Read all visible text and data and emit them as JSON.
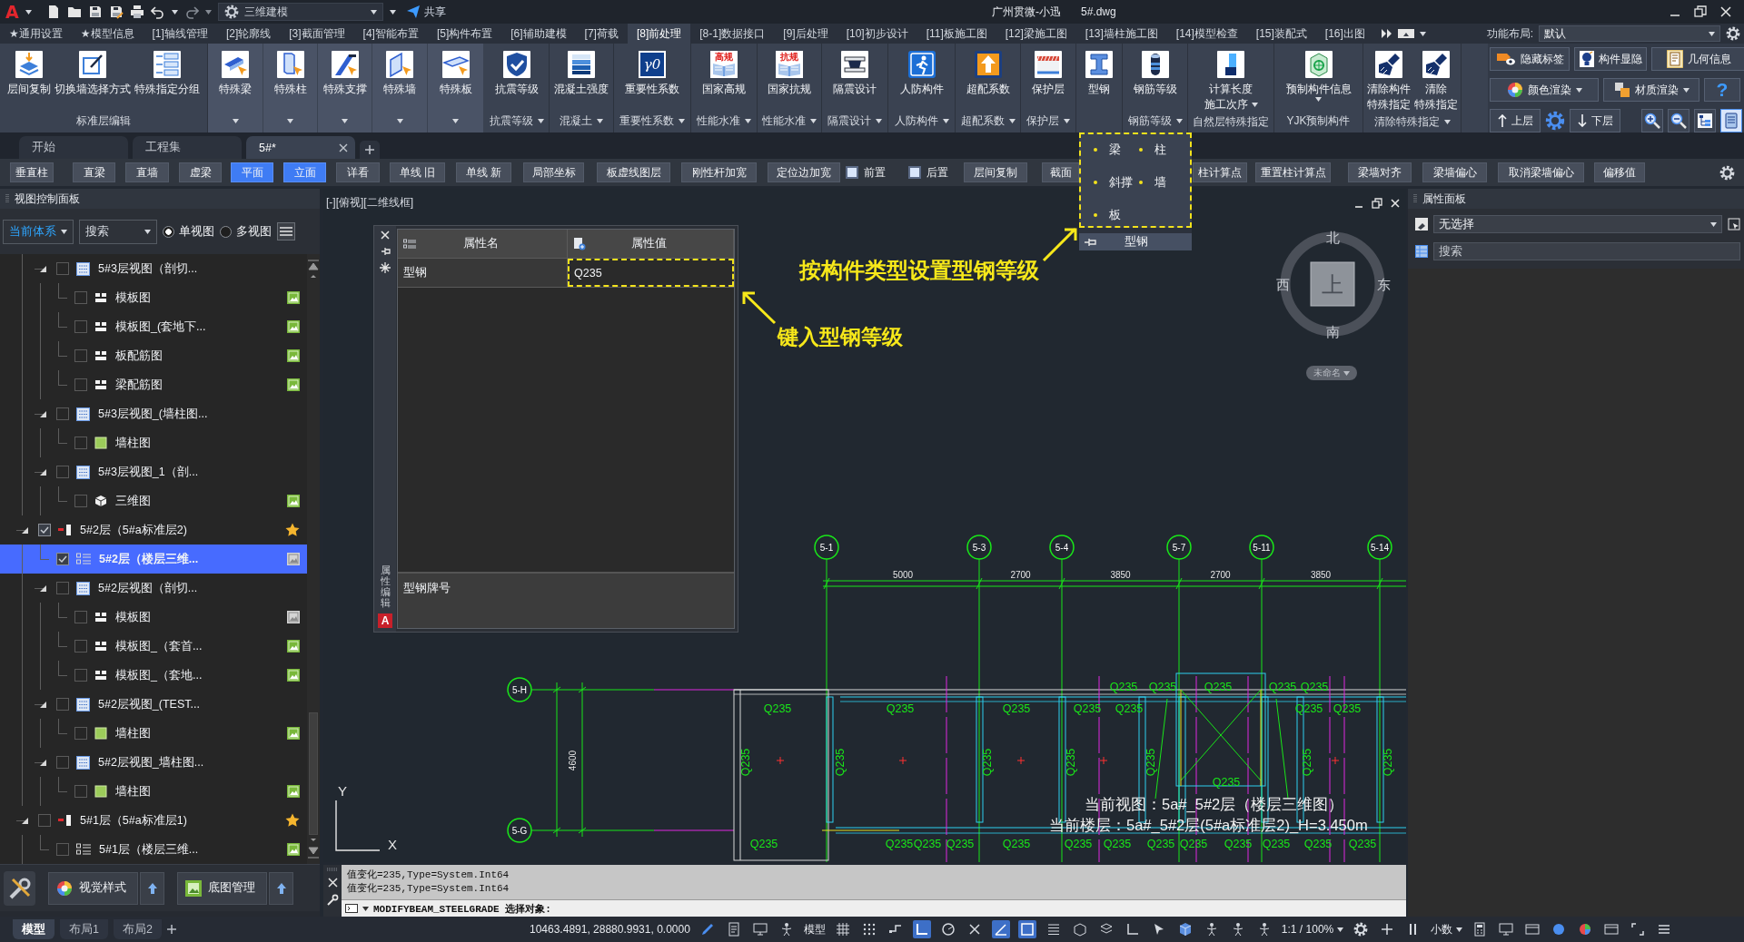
{
  "title_bar": {
    "logo": "A",
    "workspace": "三维建模",
    "share": "共享",
    "title": "广州贯微-小迅",
    "file": "5#.dwg"
  },
  "menu_tabs": [
    {
      "label": "★通用设置",
      "selected": false
    },
    {
      "label": "★模型信息",
      "selected": false
    },
    {
      "label": "[1]轴线管理",
      "selected": false
    },
    {
      "label": "[2]轮廓线",
      "selected": false
    },
    {
      "label": "[3]截面管理",
      "selected": false
    },
    {
      "label": "[4]智能布置",
      "selected": false
    },
    {
      "label": "[5]构件布置",
      "selected": false
    },
    {
      "label": "[6]辅助建模",
      "selected": false
    },
    {
      "label": "[7]荷载",
      "selected": false
    },
    {
      "label": "[8]前处理",
      "selected": true
    },
    {
      "label": "[8-1]数据接口",
      "selected": false
    },
    {
      "label": "[9]后处理",
      "selected": false
    },
    {
      "label": "[10]初步设计",
      "selected": false
    },
    {
      "label": "[11]板施工图",
      "selected": false
    },
    {
      "label": "[12]梁施工图",
      "selected": false
    },
    {
      "label": "[13]墙柱施工图",
      "selected": false
    },
    {
      "label": "[14]模型检查",
      "selected": false
    },
    {
      "label": "[15]装配式",
      "selected": false
    },
    {
      "label": "[16]出图",
      "selected": false
    }
  ],
  "layout_selector": {
    "label": "功能布局:",
    "value": "默认"
  },
  "ribbon": {
    "groups": [
      {
        "kind": "group",
        "label": "标准层编辑",
        "menu": false,
        "buttons": [
          {
            "lines": [
              "层间复制"
            ]
          },
          {
            "lines": [
              "切换墙选择方式"
            ]
          },
          {
            "lines": [
              "特殊指定分组"
            ]
          }
        ]
      },
      {
        "kind": "split",
        "buttons": [
          {
            "lines": [
              "特殊梁"
            ]
          }
        ]
      },
      {
        "kind": "split",
        "buttons": [
          {
            "lines": [
              "特殊柱"
            ]
          }
        ]
      },
      {
        "kind": "split",
        "buttons": [
          {
            "lines": [
              "特殊支撑"
            ]
          }
        ]
      },
      {
        "kind": "split",
        "buttons": [
          {
            "lines": [
              "特殊墙"
            ]
          }
        ]
      },
      {
        "kind": "split",
        "buttons": [
          {
            "lines": [
              "特殊板"
            ]
          }
        ]
      },
      {
        "kind": "group",
        "label": "抗震等级",
        "menu": true,
        "buttons": [
          {
            "lines": [
              "抗震等级"
            ]
          }
        ]
      },
      {
        "kind": "group",
        "label": "混凝土",
        "menu": true,
        "buttons": [
          {
            "lines": [
              "混凝土强度"
            ]
          }
        ]
      },
      {
        "kind": "group",
        "label": "重要性系数",
        "menu": true,
        "buttons": [
          {
            "lines": [
              "重要性系数"
            ],
            "badge": "γ0"
          }
        ]
      },
      {
        "kind": "group",
        "label": "性能水准",
        "menu": true,
        "buttons": [
          {
            "lines": [
              "国家高规"
            ],
            "badge": "高规"
          }
        ]
      },
      {
        "kind": "group",
        "label": "性能水准",
        "menu": true,
        "buttons": [
          {
            "lines": [
              "国家抗规"
            ],
            "badge": "抗规"
          }
        ]
      },
      {
        "kind": "group",
        "label": "隔震设计",
        "menu": true,
        "buttons": [
          {
            "lines": [
              "隔震设计"
            ]
          }
        ]
      },
      {
        "kind": "group",
        "label": "人防构件",
        "menu": true,
        "buttons": [
          {
            "lines": [
              "人防构件"
            ]
          }
        ]
      },
      {
        "kind": "group",
        "label": "超配系数",
        "menu": true,
        "buttons": [
          {
            "lines": [
              "超配系数"
            ]
          }
        ]
      },
      {
        "kind": "group",
        "label": "保护层",
        "menu": true,
        "buttons": [
          {
            "lines": [
              "保护层"
            ]
          }
        ]
      },
      {
        "kind": "group",
        "buttons": [
          {
            "lines": [
              "型钢"
            ]
          }
        ]
      },
      {
        "kind": "group",
        "label": "钢筋等级",
        "menu": true,
        "buttons": [
          {
            "lines": [
              "钢筋等级"
            ]
          }
        ]
      },
      {
        "kind": "group",
        "label": "自然层特殊指定",
        "menu": false,
        "buttons": [
          {
            "lines": [
              "计算长度",
              "施工次序"
            ],
            "caret": true
          }
        ]
      },
      {
        "kind": "group",
        "label": "YJK预制构件",
        "menu": false,
        "buttons": [
          {
            "lines": [
              "预制构件信息"
            ],
            "caret": true
          }
        ]
      },
      {
        "kind": "group",
        "label": "清除特殊指定",
        "menu": true,
        "buttons": [
          {
            "lines": [
              "清除构件",
              "特殊指定"
            ]
          },
          {
            "lines": [
              "清除",
              "特殊指定"
            ]
          }
        ]
      }
    ]
  },
  "quick_panel": {
    "toggles": [
      {
        "label": "隐藏标签"
      },
      {
        "label": "构件显隐"
      },
      {
        "label": "几何信息"
      }
    ],
    "render": [
      {
        "label": "颜色渲染"
      },
      {
        "label": "材质渲染"
      }
    ],
    "help": "?",
    "floor_up": "上层",
    "floor_down": "下层",
    "view_tools": [
      {
        "selected": false
      },
      {
        "selected": false
      },
      {
        "selected": false
      },
      {
        "selected": true
      }
    ]
  },
  "doc_tabs": [
    {
      "label": "开始",
      "selected": false
    },
    {
      "label": "工程集",
      "selected": false
    },
    {
      "label": "5#*",
      "selected": true
    }
  ],
  "toolbar": [
    {
      "kind": "button",
      "label": "垂直柱",
      "on": false
    },
    {
      "kind": "button",
      "label": "直梁",
      "on": false
    },
    {
      "kind": "button",
      "label": "直墙",
      "on": false
    },
    {
      "kind": "button",
      "label": "虚梁",
      "on": false
    },
    {
      "kind": "button",
      "label": "平面",
      "on": true
    },
    {
      "kind": "button",
      "label": "立面",
      "on": true
    },
    {
      "kind": "button",
      "label": "详看",
      "on": false
    },
    {
      "kind": "button",
      "label": "单线 旧",
      "on": false
    },
    {
      "kind": "button",
      "label": "单线 新",
      "on": false
    },
    {
      "kind": "button",
      "label": "局部坐标",
      "on": false
    },
    {
      "kind": "button",
      "label": "板虚线图层",
      "on": false
    },
    {
      "kind": "button",
      "label": "刚性杆加宽",
      "on": false
    },
    {
      "kind": "button",
      "label": "定位边加宽",
      "on": false
    },
    {
      "kind": "check",
      "label": "前置",
      "checked": false
    },
    {
      "kind": "check",
      "label": "后置",
      "checked": false
    },
    {
      "kind": "button",
      "label": "层间复制",
      "on": false
    },
    {
      "kind": "button",
      "label": "截面",
      "on": false
    },
    {
      "kind": "button",
      "label": "柱计算点",
      "on": false
    },
    {
      "kind": "button",
      "label": "重置柱计算点",
      "on": false
    },
    {
      "kind": "button",
      "label": "梁墙对齐",
      "on": false
    },
    {
      "kind": "button",
      "label": "梁墙偏心",
      "on": false
    },
    {
      "kind": "button",
      "label": "取消梁墙偏心",
      "on": false
    },
    {
      "kind": "button",
      "label": "偏移值",
      "on": false
    }
  ],
  "steel_popup": {
    "items": [
      "梁",
      "柱",
      "斜撑",
      "墙",
      "板"
    ],
    "title": "型钢",
    "highlighted": true
  },
  "view_panel": {
    "title": "视图控制面板",
    "system": "当前体系",
    "search": {
      "placeholder": "搜索"
    },
    "views": [
      {
        "label": "单视图",
        "selected": true
      },
      {
        "label": "多视图",
        "selected": false
      }
    ],
    "tree": [
      {
        "children": [
          {
            "label": "5#3层视图（剖切...",
            "kind": "view",
            "checked": false,
            "selected": false,
            "expanded": true,
            "children": [
              {
                "label": "模板图",
                "kind": "sheet",
                "checked": false,
                "selected": false,
                "preview": true,
                "preview_open": false
              },
              {
                "label": "模板图_(套地下...",
                "kind": "sheet",
                "checked": false,
                "selected": false,
                "preview": true,
                "preview_open": false
              },
              {
                "label": "板配筋图",
                "kind": "sheet",
                "checked": false,
                "selected": false,
                "preview": true,
                "preview_open": false
              },
              {
                "label": "梁配筋图",
                "kind": "sheet",
                "checked": false,
                "selected": false,
                "preview": true,
                "preview_open": false
              }
            ]
          },
          {
            "label": "5#3层视图_(墙柱图...",
            "kind": "view",
            "checked": false,
            "selected": false,
            "expanded": true,
            "children": [
              {
                "label": "墙柱图",
                "kind": "wall",
                "checked": false,
                "selected": false
              }
            ]
          },
          {
            "label": "5#3层视图_1（剖...",
            "kind": "view",
            "checked": false,
            "selected": false,
            "expanded": true,
            "children": [
              {
                "label": "三维图",
                "kind": "cube",
                "checked": false,
                "selected": false,
                "preview": true,
                "preview_open": false
              }
            ]
          }
        ]
      },
      {
        "label": "5#2层（5#a标准层2)",
        "kind": "floor",
        "checked": true,
        "selected": false,
        "starred": true,
        "expanded": true,
        "children": [
          {
            "label": "5#2层（楼层三维...",
            "kind": "floor3d",
            "checked": true,
            "selected": true,
            "preview": true,
            "preview_open": true
          },
          {
            "label": "5#2层视图（剖切...",
            "kind": "view",
            "checked": false,
            "selected": false,
            "expanded": true,
            "children": [
              {
                "label": "模板图",
                "kind": "sheet",
                "checked": false,
                "selected": false,
                "preview": true,
                "preview_open": true
              },
              {
                "label": "模板图_（套首...",
                "kind": "sheet",
                "checked": false,
                "selected": false,
                "preview": true,
                "preview_open": false
              },
              {
                "label": "模板图_（套地...",
                "kind": "sheet",
                "checked": false,
                "selected": false,
                "preview": true,
                "preview_open": false
              }
            ]
          },
          {
            "label": "5#2层视图_(TEST...",
            "kind": "view",
            "checked": false,
            "selected": false,
            "expanded": true,
            "children": [
              {
                "label": "墙柱图",
                "kind": "wall",
                "checked": false,
                "selected": false,
                "preview": true,
                "preview_open": false
              }
            ]
          },
          {
            "label": "5#2层视图_墙柱图...",
            "kind": "view",
            "checked": false,
            "selected": false,
            "expanded": true,
            "children": [
              {
                "label": "墙柱图",
                "kind": "wall",
                "checked": false,
                "selected": false,
                "preview": true,
                "preview_open": false
              }
            ]
          }
        ]
      },
      {
        "label": "5#1层（5#a标准层1)",
        "kind": "floor",
        "checked": false,
        "selected": false,
        "starred": true,
        "expanded": true,
        "children": [
          {
            "label": "5#1层（楼层三维...",
            "kind": "floor3d",
            "checked": false,
            "selected": false,
            "preview": true,
            "preview_open": false
          }
        ]
      }
    ],
    "tools": [
      {
        "label": "视觉样式"
      },
      {
        "label": "底图管理"
      }
    ]
  },
  "viewport": {
    "label": "[-][俯视][二维线框]",
    "compass": {
      "north": "北",
      "south": "南",
      "west": "西",
      "east": "东",
      "top": "上",
      "ucs": "未命名"
    },
    "axes": {
      "x": "X",
      "y": "Y"
    },
    "status_text": [
      "当前视图：5a#_5#2层（楼层三维图）",
      "当前楼层：5a#_5#2层(5#a标准层2)_H=3.450m"
    ]
  },
  "property_editor": {
    "side_label": "属性编辑",
    "logo": "A",
    "columns": [
      "属性名",
      "属性值"
    ],
    "rows": [
      {
        "name": "型钢",
        "value": "Q235",
        "highlighted": true
      }
    ],
    "description": "型钢牌号"
  },
  "annotations": [
    {
      "text": "按构件类型设置型钢等级"
    },
    {
      "text": "键入型钢等级"
    }
  ],
  "drawing": {
    "top_axes": [
      "5-1",
      "5-3",
      "5-4",
      "5-7",
      "5-11",
      "5-14"
    ],
    "side_axes": [
      "5-H",
      "5-G"
    ],
    "spans": [
      "5000",
      "2700",
      "3850",
      "2700",
      "3850"
    ],
    "side_span": "4600",
    "member_labels": [
      "Q235",
      "Q235",
      "Q235",
      "Q235",
      "Q235",
      "Q235",
      "Q235",
      "Q235",
      "Q235",
      "Q235",
      "Q235",
      "Q235",
      "Q235",
      "Q235",
      "Q235",
      "Q235",
      "Q235",
      "Q235",
      "Q235",
      "Q235",
      "Q235",
      "Q235",
      "Q235",
      "Q235",
      "Q235",
      "Q235",
      "Q235",
      "Q235",
      "Q235",
      "Q235",
      "Q235",
      "Q235",
      "Q235"
    ]
  },
  "command_line": {
    "history": [
      "值变化=235,Type=System.Int64",
      "值变化=235,Type=System.Int64"
    ],
    "prompt": "MODIFYBEAM_STEELGRADE 选择对象:"
  },
  "properties_panel": {
    "title": "属性面板",
    "selection": "无选择",
    "search": {
      "placeholder": "搜索"
    }
  },
  "status_bar": {
    "layouts": [
      {
        "label": "模型",
        "selected": true
      },
      {
        "label": "布局1",
        "selected": false
      },
      {
        "label": "布局2",
        "selected": false
      }
    ],
    "coordinates": "10463.4891, 28880.9931, 0.0000",
    "tools_a": [
      {
        "kind": "pen",
        "on": false
      },
      {
        "kind": "document",
        "on": false
      },
      {
        "kind": "monitor",
        "on": false
      },
      {
        "kind": "person",
        "on": false
      }
    ],
    "space": "模型",
    "tools_b": [
      {
        "kind": "grid",
        "on": false
      },
      {
        "kind": "dots",
        "on": false
      },
      {
        "kind": "step",
        "on": false
      },
      {
        "kind": "corner",
        "on": true
      },
      {
        "kind": "gauge",
        "on": false
      },
      {
        "kind": "cross",
        "on": false
      },
      {
        "kind": "angle",
        "on": true
      },
      {
        "kind": "square",
        "on": true
      },
      {
        "kind": "lines",
        "on": false
      },
      {
        "kind": "hexagon",
        "on": false
      },
      {
        "kind": "layers",
        "on": false
      },
      {
        "kind": "axes",
        "on": false
      },
      {
        "kind": "cursor",
        "on": false
      },
      {
        "kind": "cube",
        "on": false
      },
      {
        "kind": "person",
        "on": false
      },
      {
        "kind": "person",
        "on": false
      },
      {
        "kind": "person",
        "on": false
      }
    ],
    "scale": "1:1 / 100%",
    "tools_c": [
      {
        "kind": "gear",
        "on": false
      },
      {
        "kind": "plus",
        "on": false
      },
      {
        "kind": "bars",
        "on": false
      }
    ],
    "units": "小数",
    "tools_d": [
      {
        "kind": "calculator",
        "on": false
      },
      {
        "kind": "monitor",
        "on": false
      },
      {
        "kind": "window",
        "on": false
      },
      {
        "kind": "circle",
        "on": false
      },
      {
        "kind": "pie",
        "on": false
      },
      {
        "kind": "window",
        "on": false
      },
      {
        "kind": "maximize",
        "on": false
      },
      {
        "kind": "menu",
        "on": false
      }
    ]
  }
}
